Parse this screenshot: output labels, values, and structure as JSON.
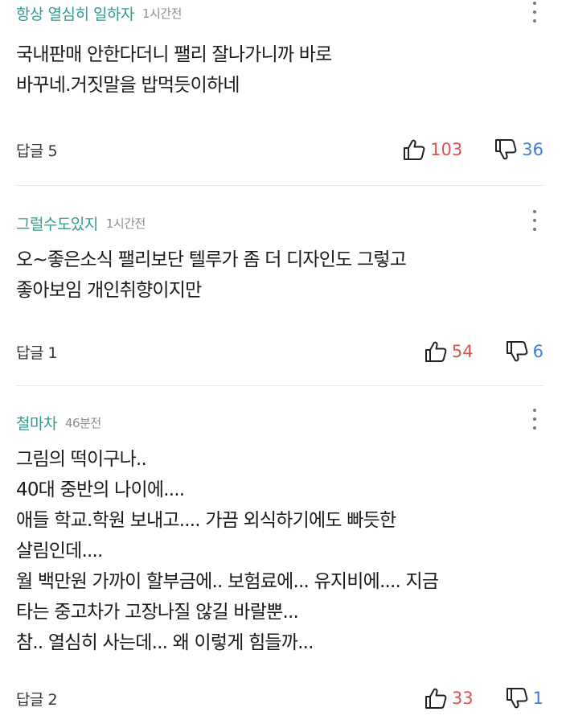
{
  "comments": [
    {
      "author": "항상 열심히 일하자",
      "time": "1시간전",
      "text": "국내판매 안한다더니 팰리 잘나가니까 바로\n바꾸네.거짓말을 밥먹듯이하네",
      "reply_label": "답글 5",
      "likes": "103",
      "dislikes": "36"
    },
    {
      "author": "그럴수도있지",
      "time": "1시간전",
      "text": "오~좋은소식  팰리보단 텔루가 좀 더 디자인도 그렇고\n좋아보임  개인취향이지만",
      "reply_label": "답글 1",
      "likes": "54",
      "dislikes": "6"
    },
    {
      "author": "철마차",
      "time": "46분전",
      "text": "그림의 떡이구나..\n40대 중반의 나이에....\n애들 학교.학원 보내고.... 가끔 외식하기에도 빠듯한\n살림인데....\n월 백만원 가까이 할부금에.. 보험료에... 유지비에.... 지금\n타는 중고차가 고장나질 않길 바랄뿐...\n참.. 열심히 사는데... 왜 이렇게 힘들까...",
      "reply_label": "답글 2",
      "likes": "33",
      "dislikes": "1"
    }
  ],
  "icons": {
    "more": "more-vertical-icon",
    "like": "thumbs-up-icon",
    "dislike": "thumbs-down-icon"
  },
  "colors": {
    "author": "#2f9b91",
    "like_count": "#d9534f",
    "dislike_count": "#3f7fd1",
    "time": "#8c8c8c"
  }
}
